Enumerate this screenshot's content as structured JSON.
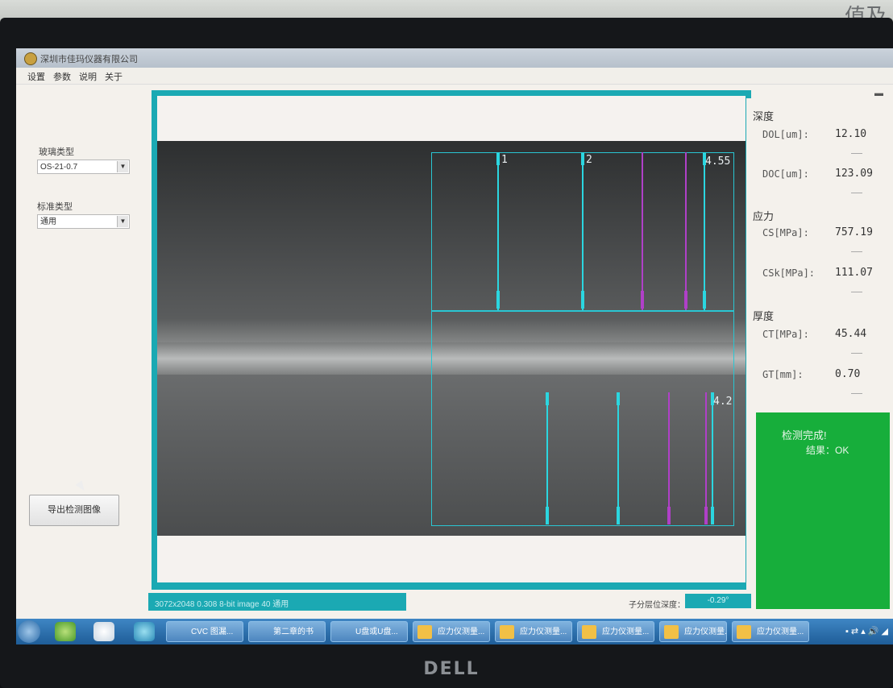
{
  "wall": {
    "text": "值及"
  },
  "monitor": {
    "brand": "DELL"
  },
  "app": {
    "title": "深圳市佳玛仪器有限公司"
  },
  "menu": [
    "设置",
    "参数",
    "说明",
    "关于"
  ],
  "left": {
    "glass_type_label": "玻璃类型",
    "glass_type_value": "OS-21-0.7",
    "standard_label": "标准类型",
    "standard_value": "通用",
    "button_label": "导出检测图像"
  },
  "viewer": {
    "upper_labels": [
      "1",
      "2",
      "4.55"
    ],
    "lower_label": "4.2",
    "status_text": "3072x2048 0.308 8-bit image 40  通用"
  },
  "depth": {
    "label": "子分层位深度：",
    "value": "-0.29°"
  },
  "measure": {
    "depth_title": "深度",
    "dol_label": "DOL[um]:",
    "dol_value": "12.10",
    "doc_label": "DOC[um]:",
    "doc_value": "123.09",
    "stress_title": "应力",
    "cs_label": "CS[MPa]:",
    "cs_value": "757.19",
    "csk_label": "CSk[MPa]:",
    "csk_value": "111.07",
    "thickness_title": "厚度",
    "ct_label": "CT[MPa]:",
    "ct_value": "45.44",
    "gt_label": "GT[mm]:",
    "gt_value": "0.70"
  },
  "result": {
    "line1": "检测完成!",
    "line2": "结果：OK"
  },
  "taskbar": {
    "buttons": [
      "CVC 图漏...",
      "第二章的书",
      "U盘或U盘...",
      "应力仪测量...",
      "应力仪测量...",
      "应力仪测量...",
      "应力仪测量...",
      "应力仪测量..."
    ],
    "tray": "▪ ⇄ ▴ 🔊 ◢"
  },
  "colors": {
    "accent": "#1ba9b3",
    "ok_green": "#17ae3b",
    "line_cyan": "#2bd6e0",
    "line_magenta": "#b040c8"
  }
}
